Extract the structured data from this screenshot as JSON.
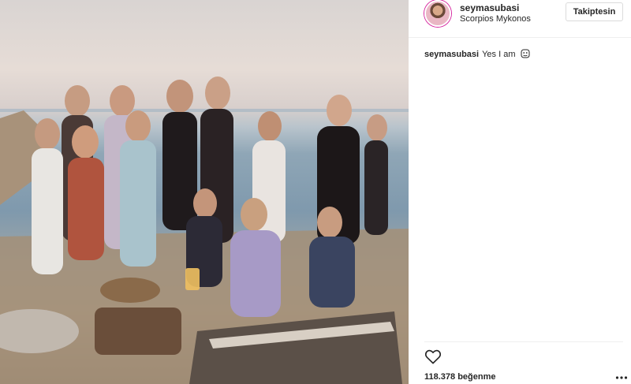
{
  "post": {
    "image": {
      "alt": "",
      "colors": {
        "sky": "#d9d4d2",
        "sea": "#7f99ad",
        "rock": "#b5a58f"
      }
    },
    "header": {
      "username": "seymasubasi",
      "location": "Scorpios Mykonos",
      "follow_label": "Takiptesin"
    },
    "caption": {
      "username": "seymasubasi",
      "text": "Yes I am",
      "emoji_icon": "face-emoji-icon"
    },
    "actions": {
      "like_icon": "heart-outline-icon",
      "likes_text": "118.378 beğenme",
      "more_icon": "more-options-icon"
    }
  }
}
